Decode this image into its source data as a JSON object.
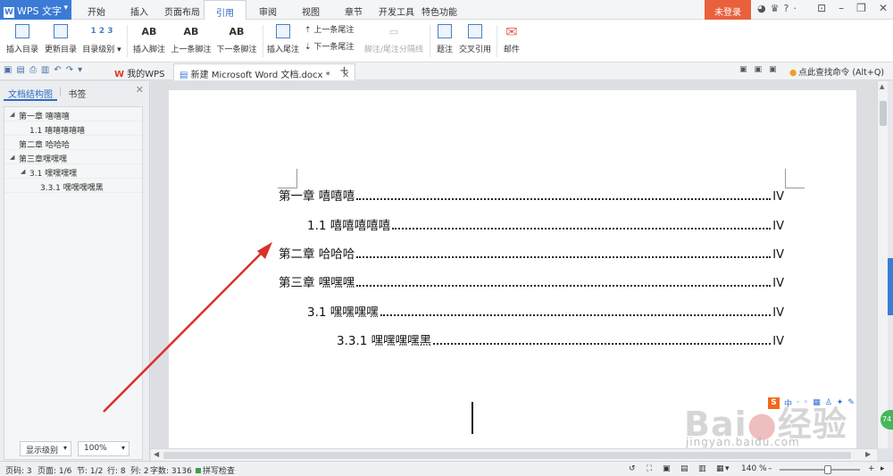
{
  "app": {
    "name": "WPS 文字",
    "login_label": "未登录",
    "help_label": "?"
  },
  "menu": {
    "tabs": [
      {
        "label": "开始"
      },
      {
        "label": "插入"
      },
      {
        "label": "页面布局"
      },
      {
        "label": "引用",
        "active": true
      },
      {
        "label": "审阅"
      },
      {
        "label": "视图"
      },
      {
        "label": "章节"
      },
      {
        "label": "开发工具"
      },
      {
        "label": "特色功能"
      }
    ]
  },
  "ribbon": {
    "insert_toc": "插入目录",
    "update_toc": "更新目录",
    "toc_level": "目录级别",
    "insert_footnote": "插入脚注",
    "prev_footnote": "上一条脚注",
    "next_footnote": "下一条脚注",
    "insert_endnote": "插入尾注",
    "prev_endnote": "上一条尾注",
    "next_endnote": "下一条尾注",
    "note_separator": "脚注/尾注分隔线",
    "caption": "题注",
    "cross_reference": "交叉引用",
    "mail": "邮件"
  },
  "doc_tabs": {
    "mywps": "我的WPS",
    "document": "新建 Microsoft Word 文档.docx *"
  },
  "find_command": "点此查找命令 (Alt+Q)",
  "nav_pane": {
    "tab_structure": "文档结构图",
    "tab_bookmarks": "书签",
    "items": [
      {
        "label": "第一章 嘻嘻嘻",
        "expandable": true
      },
      {
        "label": "1.1 嘻嘻嘻嘻嘻",
        "expandable": false
      },
      {
        "label": "第二章 哈哈哈",
        "expandable": false
      },
      {
        "label": "第三章嘿嘿嘿",
        "expandable": true
      },
      {
        "label": "3.1 嘿嘿嘿嘿",
        "expandable": true
      },
      {
        "label": "3.3.1 嘿嘿嘿嘿黑",
        "expandable": false
      }
    ],
    "display_level": "显示级别",
    "zoom": "100%"
  },
  "document": {
    "toc": [
      {
        "title": "第一章  嘻嘻嘻",
        "page": "IV"
      },
      {
        "title": "1.1  嘻嘻嘻嘻嘻",
        "page": "IV"
      },
      {
        "title": "第二章  哈哈哈",
        "page": "IV"
      },
      {
        "title": "第三章  嘿嘿嘿",
        "page": "IV"
      },
      {
        "title": "3.1  嘿嘿嘿嘿",
        "page": "IV"
      },
      {
        "title": "3.3.1  嘿嘿嘿嘿黑",
        "page": "IV"
      }
    ]
  },
  "watermark": {
    "logo_text": "Bai",
    "logo_text2": "经验",
    "url": "jingyan.baidu.com"
  },
  "statusbar": {
    "page_code": "页码: 3",
    "page": "页面: 1/6",
    "section": "节: 1/2",
    "row": "行: 8",
    "col": "列: 2",
    "word_count": "字数: 3136",
    "spell_check": "拼写检查",
    "zoom": "140 %"
  },
  "side_badge": "74",
  "colors": {
    "accent": "#3b7bd6",
    "login": "#e9603c",
    "arrow": "#d9312b"
  }
}
